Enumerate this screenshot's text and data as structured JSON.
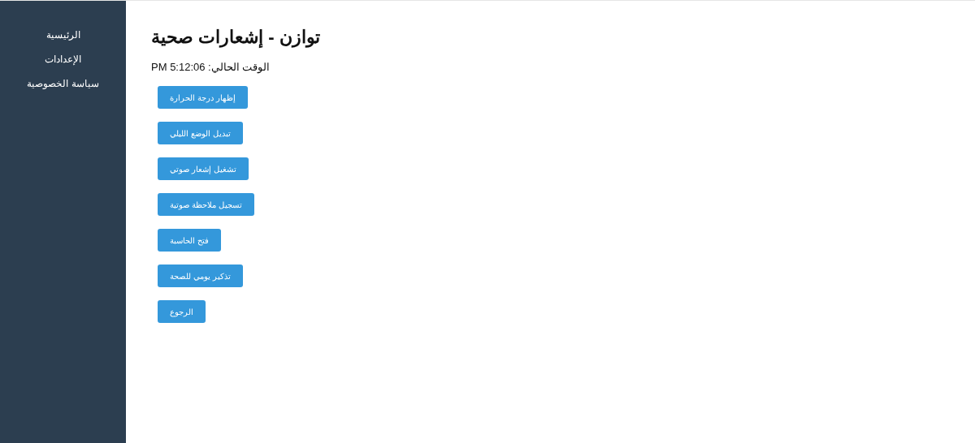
{
  "sidebar": {
    "items": [
      {
        "label": "الرئيسية"
      },
      {
        "label": "الإعدادات"
      },
      {
        "label": "سياسة الخصوصية"
      }
    ]
  },
  "main": {
    "title": "توازن - إشعارات صحية",
    "clock": "الوقت الحالي: 5:12:06 PM",
    "buttons": [
      "إظهار درجة الحرارة",
      "تبديل الوضع الليلي",
      "تشغيل إشعار صوتي",
      "تسجيل ملاحظة صوتية",
      "فتح الحاسبة",
      "تذكير يومي للصحة",
      "الرجوع"
    ]
  }
}
